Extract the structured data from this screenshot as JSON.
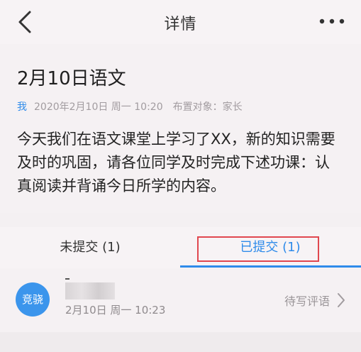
{
  "header": {
    "title": "详情",
    "back_icon": "chevron-left-icon",
    "more_icon": "more-horizontal-icon"
  },
  "post": {
    "title": "2月10日语文",
    "author": "我",
    "datetime": "2020年2月10日 周一 10:20",
    "audience": "布置对象：家长",
    "content": "今天我们在语文课堂上学习了XX，新的知识需要及时的巩固，请各位同学及时完成下述功课：认真阅读并背诵今日所学的内容。"
  },
  "tabs": {
    "pending": "未提交 (1)",
    "submitted": "已提交 (1)",
    "active": "submitted",
    "accent": "#2f8bea",
    "highlight": "#e0474f"
  },
  "submissions": [
    {
      "avatar_text": "竞骁",
      "name": "-",
      "time": "2月10日 周一 10:23",
      "status": "待写评语",
      "status_icon": "chevron-right-icon"
    }
  ]
}
